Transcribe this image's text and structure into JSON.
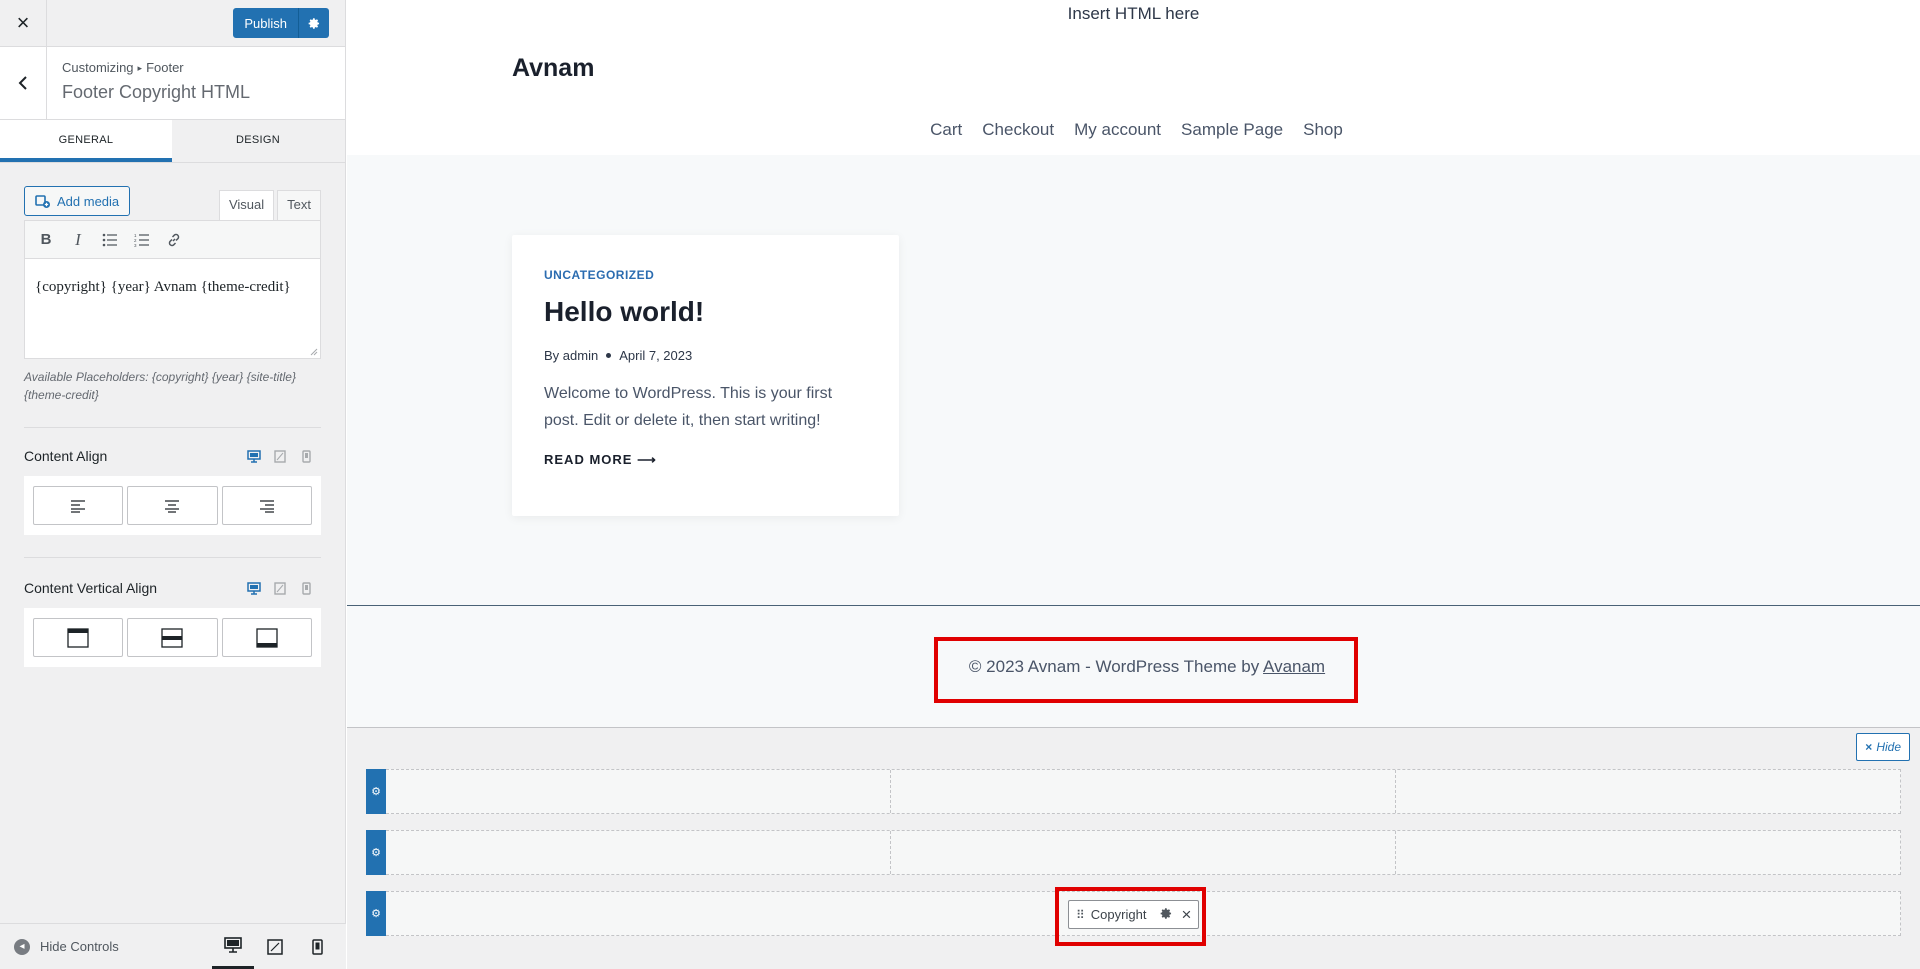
{
  "sidebar": {
    "close_label": "×",
    "publish_label": "Publish",
    "breadcrumb_root": "Customizing",
    "breadcrumb_section": "Footer",
    "section_title": "Footer Copyright HTML",
    "tabs": [
      {
        "label": "General"
      },
      {
        "label": "Design"
      }
    ],
    "editor": {
      "add_media_label": "Add media",
      "visual_tab": "Visual",
      "text_tab": "Text",
      "content": "{copyright} {year} Avnam {theme-credit}",
      "hint": "Available Placeholders: {copyright} {year} {site-title} {theme-credit}"
    },
    "content_align_label": "Content Align",
    "content_vertical_align_label": "Content Vertical Align",
    "hide_controls_label": "Hide Controls"
  },
  "preview": {
    "top_html": "Insert HTML here",
    "site_title": "Avnam",
    "nav": [
      "Cart",
      "Checkout",
      "My account",
      "Sample Page",
      "Shop"
    ],
    "post": {
      "category": "UNCATEGORIZED",
      "title": "Hello world!",
      "author_prefix": "By",
      "author": "admin",
      "date": "April 7, 2023",
      "excerpt": "Welcome to WordPress. This is your first post. Edit or delete it, then start writing!",
      "read_more": "READ MORE",
      "read_more_arrow": "⟶"
    },
    "footer": {
      "copyright_text": "© 2023 Avnam - WordPress Theme by",
      "credit_link": "Avanam"
    },
    "builder": {
      "hide_label": "Hide",
      "widget_label": "Copyright"
    }
  },
  "colors": {
    "accent": "#2271b1",
    "highlight": "#e00000",
    "post_category": "#2b6cb0"
  }
}
